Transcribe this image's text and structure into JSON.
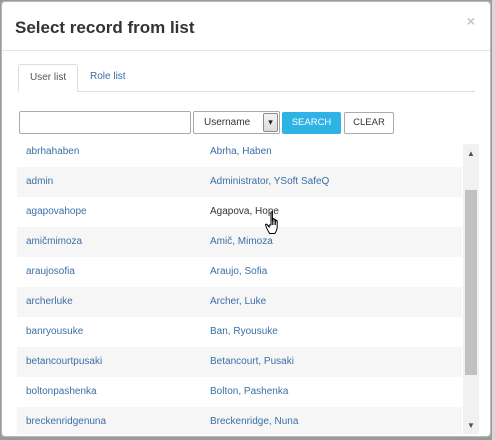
{
  "dialog": {
    "title": "Select record from list",
    "close_glyph": "×"
  },
  "tabs": [
    {
      "label": "User list",
      "active": true
    },
    {
      "label": "Role list",
      "active": false
    }
  ],
  "search": {
    "value": "",
    "placeholder": "",
    "field_select": "Username",
    "select_arrow": "▾",
    "search_label": "SEARCH",
    "clear_label": "CLEAR"
  },
  "rows": [
    {
      "username": "abrhahaben",
      "fullname": "Abrha, Haben"
    },
    {
      "username": "admin",
      "fullname": "Administrator, YSoft SafeQ"
    },
    {
      "username": "agapovahope",
      "fullname": "Agapova, Hope"
    },
    {
      "username": "amičmimoza",
      "fullname": "Amič, Mimoza"
    },
    {
      "username": "araujosofia",
      "fullname": "Araujo, Sofia"
    },
    {
      "username": "archerluke",
      "fullname": "Archer, Luke"
    },
    {
      "username": "banryousuke",
      "fullname": "Ban, Ryousuke"
    },
    {
      "username": "betancourtpusaki",
      "fullname": "Betancourt, Pusaki"
    },
    {
      "username": "boltonpashenka",
      "fullname": "Bolton, Pashenka"
    },
    {
      "username": "breckenridgenuna",
      "fullname": "Breckenridge, Nuna"
    }
  ],
  "scrollbar": {
    "up_glyph": "▲",
    "down_glyph": "▼"
  },
  "colors": {
    "link": "#3b6ea8",
    "search_button": "#2fb2e6",
    "row_alt": "#f6f6f6"
  }
}
